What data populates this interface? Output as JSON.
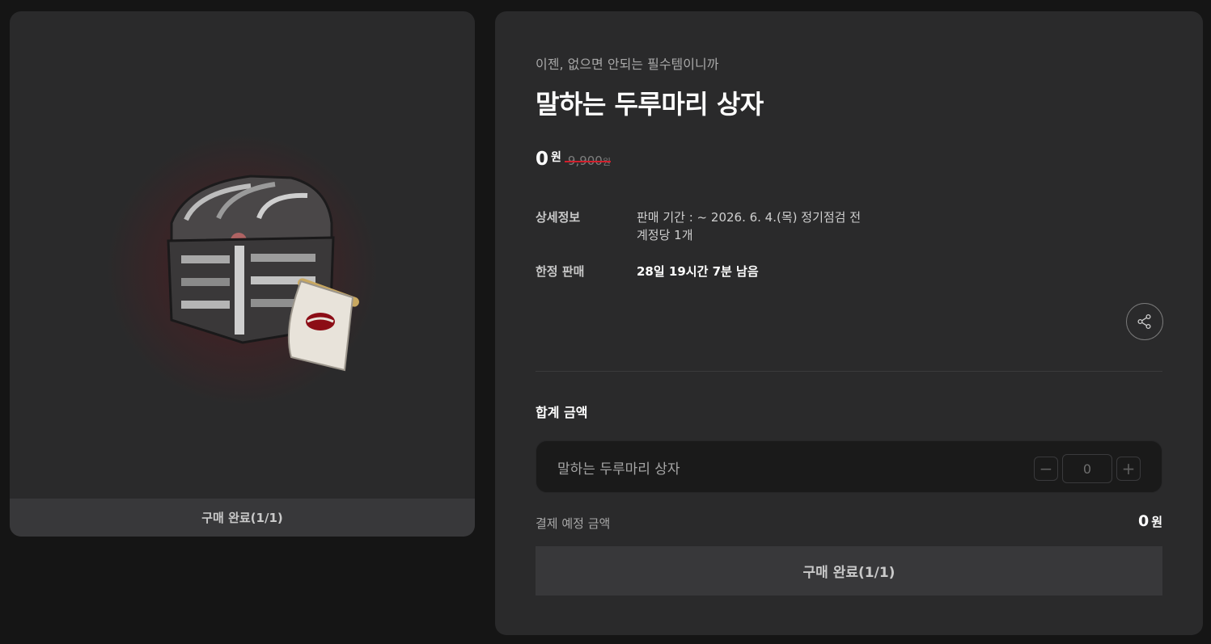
{
  "product": {
    "tagline": "이젠, 없으면 안되는 필수템이니까",
    "title": "말하는 두루마리 상자",
    "image_icon": "treasure-chest-with-scroll",
    "price": {
      "current": "0",
      "unit": "원",
      "original": "9,900",
      "original_unit": "원"
    },
    "details": {
      "label": "상세정보",
      "lines": [
        "판매 기간 : ~ 2026. 6. 4.(목) 정기점검 전",
        "계정당 1개"
      ]
    },
    "limited": {
      "label": "한정 판매",
      "value": "28일 19시간 7분 남음"
    },
    "share_icon": "share-icon",
    "status_label": "구매 완료(1/1)"
  },
  "order": {
    "total_label": "합계 금액",
    "item_name": "말하는 두루마리 상자",
    "quantity": "0",
    "minus": "−",
    "plus": "+",
    "payment_label": "결제 예정 금액",
    "payment_amount": "0",
    "payment_unit": "원",
    "buy_label": "구매 완료(1/1)"
  },
  "colors": {
    "background": "#151515",
    "card": "#2a2a2b",
    "button": "#38383a",
    "strike": "#d0202d"
  }
}
